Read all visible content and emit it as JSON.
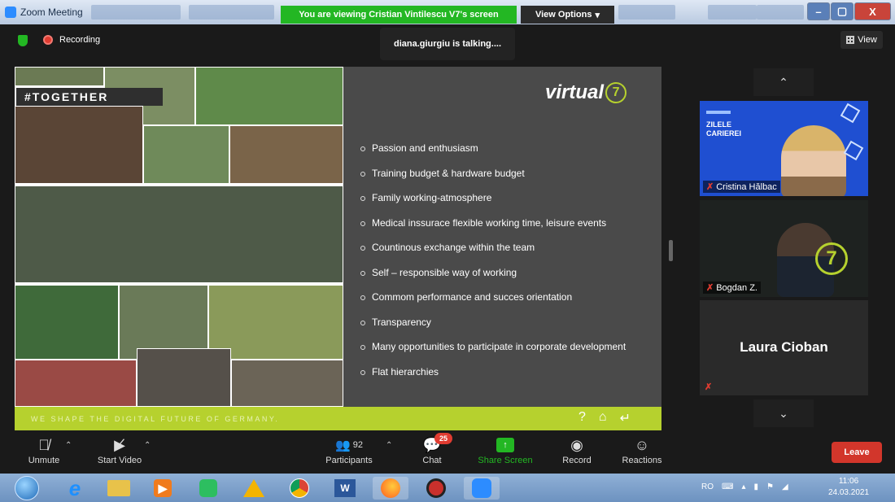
{
  "window": {
    "title": "Zoom Meeting",
    "viewing_banner": "You are viewing Cristian Vintilescu V7's screen",
    "view_options": "View Options",
    "minimize": "–",
    "maximize": "▢",
    "close": "X"
  },
  "topbar": {
    "recording_label": "Recording",
    "talking_indicator": "diana.giurgiu is talking....",
    "view_label": "View"
  },
  "slide": {
    "tag": "#TOGETHER",
    "logo_text": "virtual",
    "logo_number": "7",
    "bullets": [
      "Passion and enthusiasm",
      "Training budget & hardware budget",
      "Family working-atmosphere",
      "Medical inssurace flexible working time, leisure events",
      "Countinous exchange within the team",
      "Self – responsible way of working",
      "Commom performance and succes orientation",
      "Transparency",
      "Many opportunities to participate in corporate development",
      "Flat hierarchies"
    ],
    "footer_text": "WE SHAPE THE DIGITAL FUTURE OF GERMANY.",
    "footer_icons": [
      "?",
      "⌂",
      "↵"
    ]
  },
  "participants_panel": {
    "up_arrow": "⌃",
    "down_arrow": "⌄",
    "tiles": [
      {
        "name": "Cristina Hălbac",
        "banner_line1": "ZILELE",
        "banner_line2": "CARIEREI"
      },
      {
        "name": "Bogdan Z.",
        "logo_number": "7"
      },
      {
        "name": "Laura Cioban"
      }
    ]
  },
  "toolbar": {
    "unmute": "Unmute",
    "start_video": "Start Video",
    "participants": "Participants",
    "participants_count": "92",
    "chat": "Chat",
    "chat_badge": "25",
    "share_screen": "Share Screen",
    "record": "Record",
    "reactions": "Reactions",
    "leave": "Leave"
  },
  "taskbar": {
    "language": "RO",
    "time": "11:06",
    "date": "24.03.2021"
  },
  "colors": {
    "accent_green": "#b6d12e",
    "share_green": "#23b723",
    "leave_red": "#d2362b",
    "slide_gray": "#4a4a4a"
  }
}
